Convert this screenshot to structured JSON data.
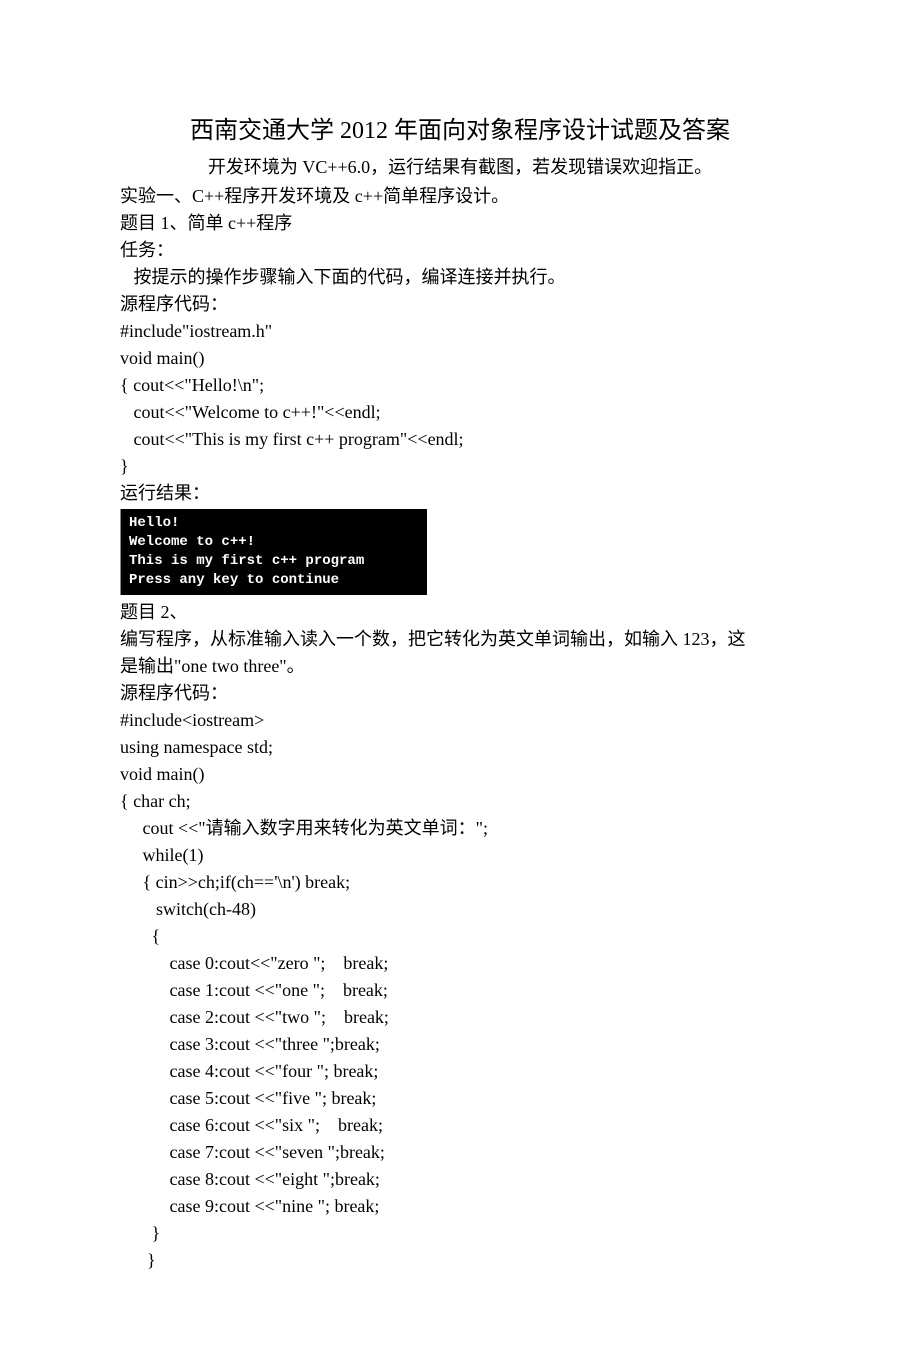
{
  "title": "西南交通大学 2012 年面向对象程序设计试题及答案",
  "subtitle": "开发环境为 VC++6.0，运行结果有截图，若发现错误欢迎指正。",
  "lines_a": [
    "实验一、C++程序开发环境及 c++简单程序设计。",
    "题目 1、简单 c++程序",
    "任务：",
    "   按提示的操作步骤输入下面的代码，编译连接并执行。",
    "源程序代码：",
    "#include\"iostream.h\"",
    "void main()",
    "{ cout<<\"Hello!\\n\";",
    "   cout<<\"Welcome to c++!\"<<endl;",
    "   cout<<\"This is my first c++ program\"<<endl;",
    "}",
    "运行结果："
  ],
  "console": [
    "Hello!",
    "Welcome to c++!",
    "This is my first c++ program",
    "Press any key to continue"
  ],
  "lines_b": [
    "题目 2、",
    "编写程序，从标准输入读入一个数，把它转化为英文单词输出，如输入 123，这",
    "是输出\"one two three\"。",
    "源程序代码：",
    "#include<iostream>",
    "using namespace std;",
    "void main()",
    "{ char ch;",
    "     cout <<\"请输入数字用来转化为英文单词：\";",
    "     while(1)",
    "     { cin>>ch;if(ch=='\\n') break;",
    "        switch(ch-48)",
    "       {",
    "           case 0:cout<<\"zero \";    break;",
    "           case 1:cout <<\"one \";    break;",
    "           case 2:cout <<\"two \";    break;",
    "           case 3:cout <<\"three \";break;",
    "           case 4:cout <<\"four \"; break;",
    "           case 5:cout <<\"five \"; break;",
    "           case 6:cout <<\"six \";    break;",
    "           case 7:cout <<\"seven \";break;",
    "           case 8:cout <<\"eight \";break;",
    "           case 9:cout <<\"nine \"; break;",
    "       }",
    "      }"
  ]
}
